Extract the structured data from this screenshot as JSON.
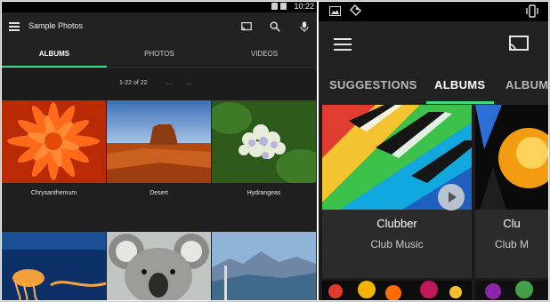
{
  "left": {
    "status_time": "10:22",
    "app_title": "Sample Photos",
    "tabs": [
      {
        "label": "ALBUMS",
        "active": true
      },
      {
        "label": "PHOTOS",
        "active": false
      },
      {
        "label": "VIDEOS",
        "active": false
      }
    ],
    "pager": {
      "text": "1-22 of 22",
      "prev_icon": "arrow-left-icon",
      "next_icon": "arrow-right-icon"
    },
    "toolbar_icons": [
      "cast-icon",
      "search-icon",
      "microphone-icon"
    ],
    "albums": [
      {
        "caption": "Chrysanthemum"
      },
      {
        "caption": "Desert"
      },
      {
        "caption": "Hydrangeas"
      },
      {
        "caption": ""
      },
      {
        "caption": ""
      },
      {
        "caption": ""
      }
    ]
  },
  "right": {
    "status_icons": [
      "image-icon",
      "tag-icon",
      "vibrate-icon"
    ],
    "toolbar_icons": [
      "menu-icon",
      "cast-icon"
    ],
    "tabs": [
      {
        "label": "SUGGESTIONS",
        "active": false
      },
      {
        "label": "ALBUMS",
        "active": true
      },
      {
        "label": "ALBUM",
        "active": false
      }
    ],
    "cards": [
      {
        "title": "Clubber",
        "subtitle": "Club Music",
        "has_play": true
      },
      {
        "title": "Clu",
        "subtitle": "Club M",
        "has_play": false
      }
    ]
  },
  "colors": {
    "accent": "#3ddc84",
    "background_dark": "#1f1f1f"
  }
}
